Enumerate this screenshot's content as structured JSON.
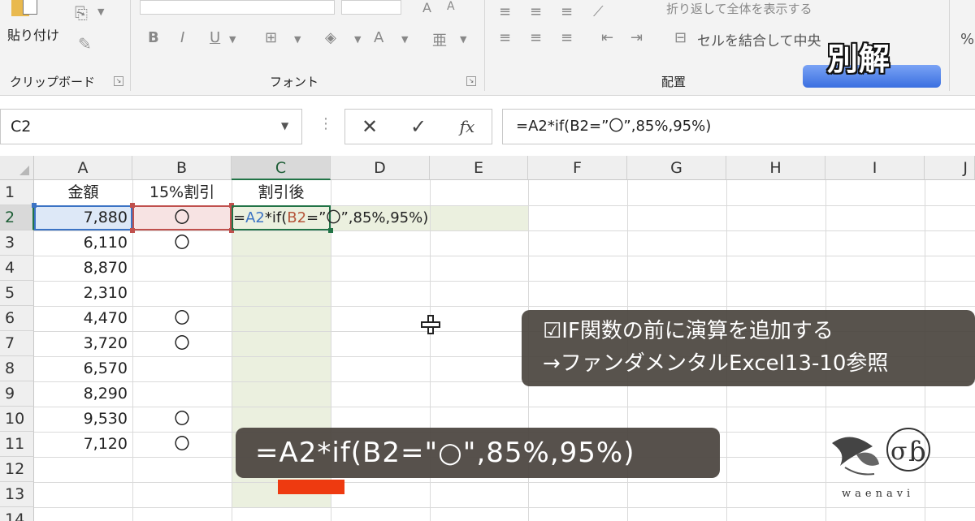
{
  "ribbon": {
    "clipboard": {
      "paste_label": "貼り付け",
      "group_label": "クリップボード"
    },
    "font": {
      "group_label": "フォント",
      "bold": "B",
      "italic": "I",
      "underline": "U"
    },
    "alignment": {
      "group_label": "配置",
      "merge_label": "セルを結合して中央",
      "wrap_label": "折り返して全体を表示する"
    },
    "number": {
      "percent": "%"
    },
    "overlay_title": "別解"
  },
  "formula_bar": {
    "name_box": "C2",
    "cancel": "✕",
    "enter": "✓",
    "fx": "fx",
    "formula": "=A2*if(B2=”〇”,85%,95%)"
  },
  "sheet": {
    "columns": [
      "A",
      "B",
      "C",
      "D",
      "E",
      "F",
      "G",
      "H",
      "I",
      "J"
    ],
    "selected_column": "C",
    "rows": [
      "1",
      "2",
      "3",
      "4",
      "5",
      "6",
      "7",
      "8",
      "9",
      "10",
      "11",
      "12",
      "13",
      "14"
    ],
    "selected_row": "2",
    "headers": {
      "amount": "金額",
      "discount15": "15%割引",
      "after_discount": "割引後"
    },
    "data": [
      {
        "a": "7,880",
        "b": "〇"
      },
      {
        "a": "6,110",
        "b": "〇"
      },
      {
        "a": "8,870",
        "b": ""
      },
      {
        "a": "2,310",
        "b": ""
      },
      {
        "a": "4,470",
        "b": "〇"
      },
      {
        "a": "3,720",
        "b": "〇"
      },
      {
        "a": "6,570",
        "b": ""
      },
      {
        "a": "8,290",
        "b": ""
      },
      {
        "a": "9,530",
        "b": "〇"
      },
      {
        "a": "7,120",
        "b": "〇"
      }
    ],
    "edit": {
      "eq": "=",
      "ref_a": "A2",
      "mul_if": "*if(",
      "ref_b": "B2",
      "rest": "=”〇”,85%,95%)"
    },
    "colors": {
      "ref_a": "#3b73c4",
      "ref_b": "#c0504d",
      "selection": "#217346"
    }
  },
  "note": {
    "line1": "☑IF関数の前に演算を追加する",
    "line2": "→ファンダメンタルExcel13-10参照"
  },
  "caption": {
    "formula": "=A2*if(B2=\"○\",85%,95%)"
  },
  "logo": {
    "text": "waenavi"
  }
}
